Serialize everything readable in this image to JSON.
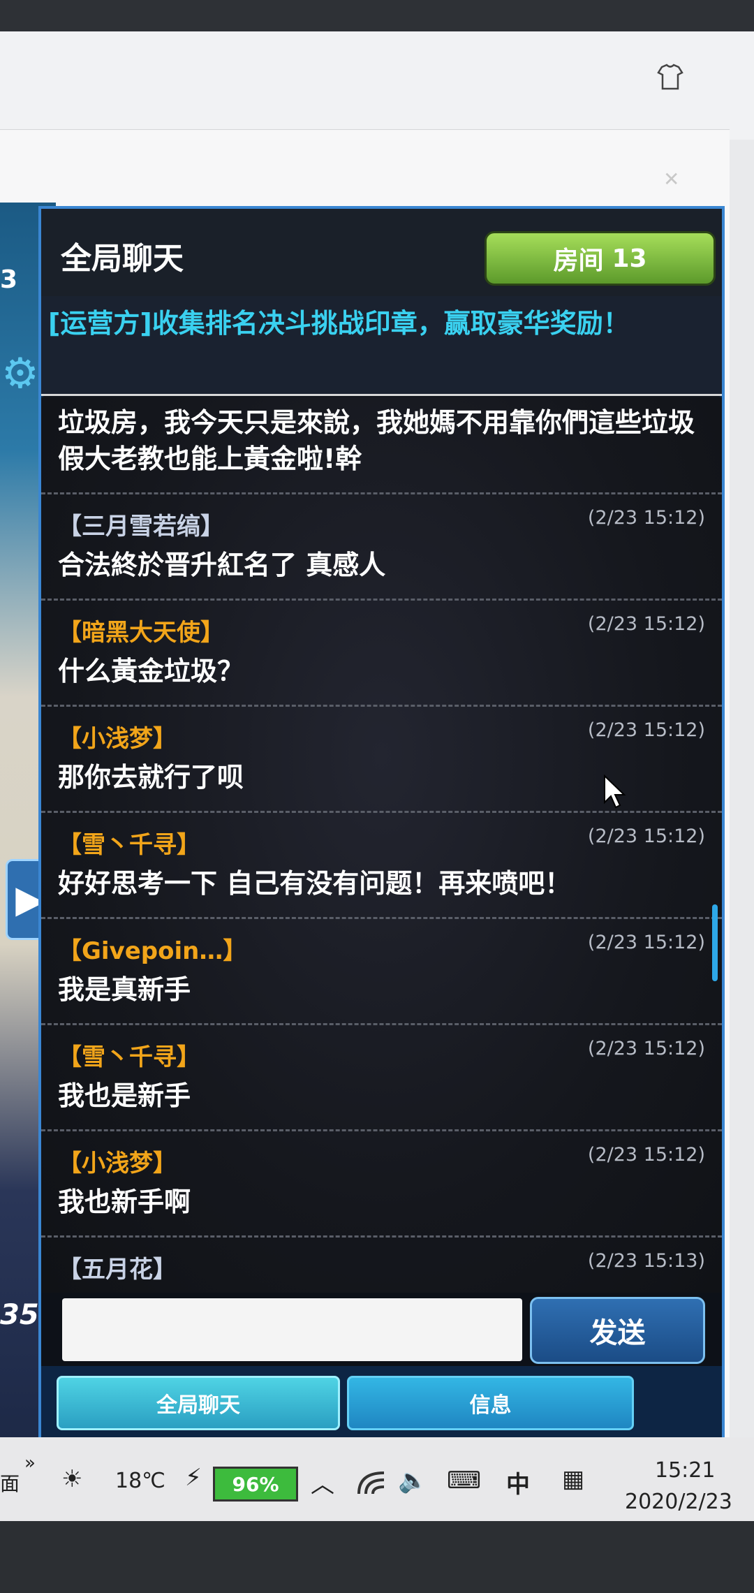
{
  "chat": {
    "title": "全局聊天",
    "room_label": "房间",
    "room_number": "13",
    "announcement": "[运营方]收集排名决斗挑战印章，赢取豪华奖励！",
    "messages": [
      {
        "user": "",
        "time": "",
        "text": "垃圾房，我今天只是來說，我她媽不用靠你們這些垃圾假大老教也能上黃金啦!幹",
        "color": "#ffffff"
      },
      {
        "user": "【三月雪若缟】",
        "time": "(2/23 15:12)",
        "text": "合法終於晋升紅名了 真感人",
        "color": "#c9d3e6"
      },
      {
        "user": "【暗黑大天使】",
        "time": "(2/23 15:12)",
        "text": "什么黃金垃圾？",
        "color": "#f2a51a"
      },
      {
        "user": "【小浅梦】",
        "time": "(2/23 15:12)",
        "text": "那你去就行了呗",
        "color": "#f2a51a"
      },
      {
        "user": "【雪丶千寻】",
        "time": "(2/23 15:12)",
        "text": "好好思考一下  自己有没有问题！再来喷吧！",
        "color": "#f2a51a"
      },
      {
        "user": "【Givepoin…】",
        "time": "(2/23 15:12)",
        "text": "我是真新手",
        "color": "#f2a51a"
      },
      {
        "user": "【雪丶千寻】",
        "time": "(2/23 15:12)",
        "text": "我也是新手",
        "color": "#f2a51a"
      },
      {
        "user": "【小浅梦】",
        "time": "(2/23 15:12)",
        "text": "我也新手啊",
        "color": "#f2a51a"
      },
      {
        "user": "【五月花】",
        "time": "(2/23 15:13)",
        "text": "",
        "color": "#c9d3e6"
      }
    ],
    "input_value": "",
    "send_label": "发送",
    "tabs": [
      "全局聊天",
      "信息"
    ]
  },
  "left_strip": {
    "top_number": "3",
    "bottom_number": "35"
  },
  "taskbar": {
    "temperature": "18℃",
    "battery": "96%",
    "ime": "中",
    "time": "15:21",
    "date": "2020/2/23",
    "edge_text": "面"
  }
}
